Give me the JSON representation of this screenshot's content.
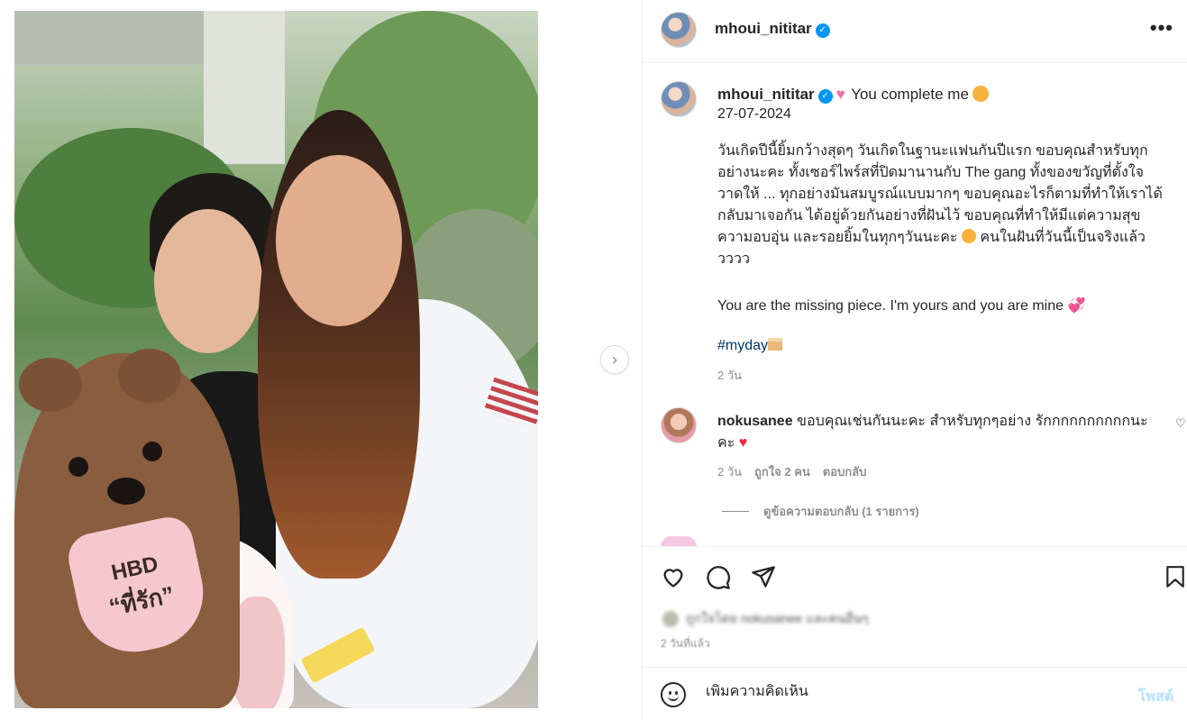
{
  "post": {
    "username": "mhoui_nititar",
    "verified_glyph": "✓",
    "more_glyph": "•••",
    "carousel": {
      "slides": 6,
      "active_index": 0
    },
    "photo_text": {
      "line1": "HBD",
      "line2": "“ที่รัก”"
    }
  },
  "caption": {
    "username": "mhoui_nititar",
    "title_text": "You complete me",
    "heart_glyph": "♥",
    "date": "27-07-2024",
    "body": "วันเกิดปีนี้ยิ้มกว้างสุดๆ วันเกิดในฐานะแฟนกันปีแรก ขอบคุณสำหรับทุกอย่างนะคะ ทั้งเซอร์ไพร์สที่ปิดมานานกับ The gang ทั้งของขวัญที่ตั้งใจวาดให้ ... ทุกอย่างมันสมบูรณ์แบบมากๆ ขอบคุณอะไรก็ตามที่ทำให้เราได้กลับมาเจอกัน ได้อยู่ด้วยกันอย่างที่ฝันไว้ ขอบคุณที่ทำให้มีแต่ความสุข ความอบอุ่น และรอยยิ้มในทุกๆวันนะคะ",
    "body_tail": "คนในฝันที่วันนี้เป็นจริงแล้ววววว",
    "english": "You are the missing piece. I'm yours and you are mine",
    "hearts_glyph": "💞",
    "hashtag": "#myday",
    "age": "2 วัน"
  },
  "comment": {
    "username": "nokusanee",
    "text": "ขอบคุณเช่นกันนะคะ สำหรับทุกๆอย่าง รักกกกกกกกกกนะคะ",
    "heart_glyph": "♥",
    "like_glyph": "♡",
    "age": "2 วัน",
    "likes": "ถูกใจ 2 คน",
    "reply": "ตอบกลับ",
    "view_replies": "ดูข้อความตอบกลับ (1 รายการ)"
  },
  "footer": {
    "likes_text": "ถูกใจโดย nokusanee และคนอื่นๆ",
    "time_ago": "2 วันที่แล้ว",
    "comment_placeholder": "เพิ่มความคิดเห็น",
    "post_label": "โพสต์"
  },
  "icons": {
    "next": "›"
  },
  "colors": {
    "verified": "#0095f6",
    "hashtag": "#00376b",
    "muted": "#8e8e8e",
    "post_disabled": "#b2dffc"
  }
}
